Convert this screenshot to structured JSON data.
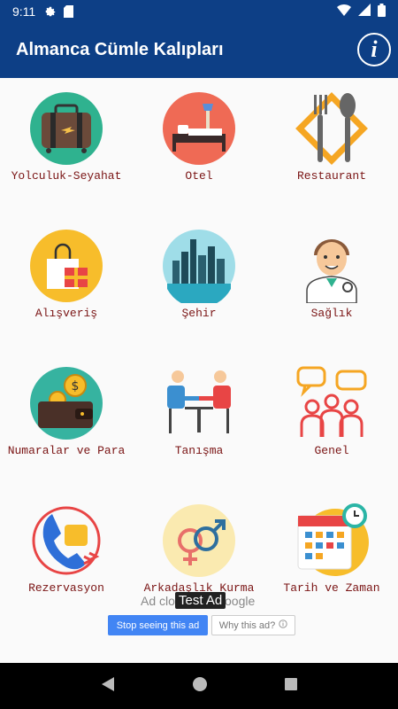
{
  "status_bar": {
    "time": "9:11"
  },
  "app_bar": {
    "title": "Almanca Cümle Kalıpları",
    "info_label": "i"
  },
  "categories": [
    {
      "label": "Yolculuk-Seyahat",
      "icon": "luggage-icon"
    },
    {
      "label": "Otel",
      "icon": "hotel-bed-icon"
    },
    {
      "label": "Restaurant",
      "icon": "fork-spoon-icon"
    },
    {
      "label": "Alışveriş",
      "icon": "shopping-bag-icon"
    },
    {
      "label": "Şehir",
      "icon": "city-skyline-icon"
    },
    {
      "label": "Sağlık",
      "icon": "doctor-icon"
    },
    {
      "label": "Numaralar ve Para",
      "icon": "wallet-coins-icon"
    },
    {
      "label": "Tanışma",
      "icon": "meeting-icon"
    },
    {
      "label": "Genel",
      "icon": "chat-people-icon"
    },
    {
      "label": "Rezervasyon",
      "icon": "phone-call-icon"
    },
    {
      "label": "Arkadaşlık Kurma",
      "icon": "gender-symbols-icon"
    },
    {
      "label": "Tarih ve Zaman",
      "icon": "calendar-clock-icon"
    }
  ],
  "ad": {
    "closed_text": "Ad clo",
    "test_ad": "Test Ad",
    "google_text": "oogle",
    "stop_button": "Stop seeing this ad",
    "why_button": "Why this ad?"
  },
  "colors": {
    "primary": "#0d3f86",
    "label": "#7a1414",
    "ad_button": "#4285f4"
  }
}
